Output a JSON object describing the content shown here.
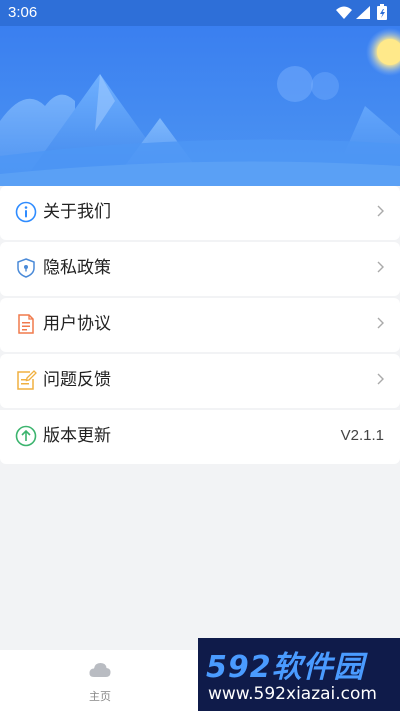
{
  "status_bar": {
    "time": "3:06",
    "icons": [
      "wifi-icon",
      "signal-icon",
      "battery-icon"
    ]
  },
  "menu": {
    "items": [
      {
        "label": "关于我们",
        "icon": "info-icon",
        "icon_color": "#2f8cff"
      },
      {
        "label": "隐私政策",
        "icon": "shield-icon",
        "icon_color": "#4a8ad8"
      },
      {
        "label": "用户协议",
        "icon": "document-icon",
        "icon_color": "#f07a4c"
      },
      {
        "label": "问题反馈",
        "icon": "edit-note-icon",
        "icon_color": "#f0b040"
      }
    ],
    "version": {
      "label": "版本更新",
      "icon": "upload-arrow-icon",
      "icon_color": "#3cb46e",
      "value": "V2.1.1"
    }
  },
  "bottom_nav": {
    "home_label": "主页",
    "home_icon": "cloud-icon"
  },
  "watermark": {
    "brand": "592软件园",
    "url": "www.592xiazai.com"
  },
  "colors": {
    "status_bar": "#2e6fd8",
    "banner_top": "#3f86f0",
    "banner_bottom": "#5aa0f5",
    "background": "#f2f3f5"
  }
}
